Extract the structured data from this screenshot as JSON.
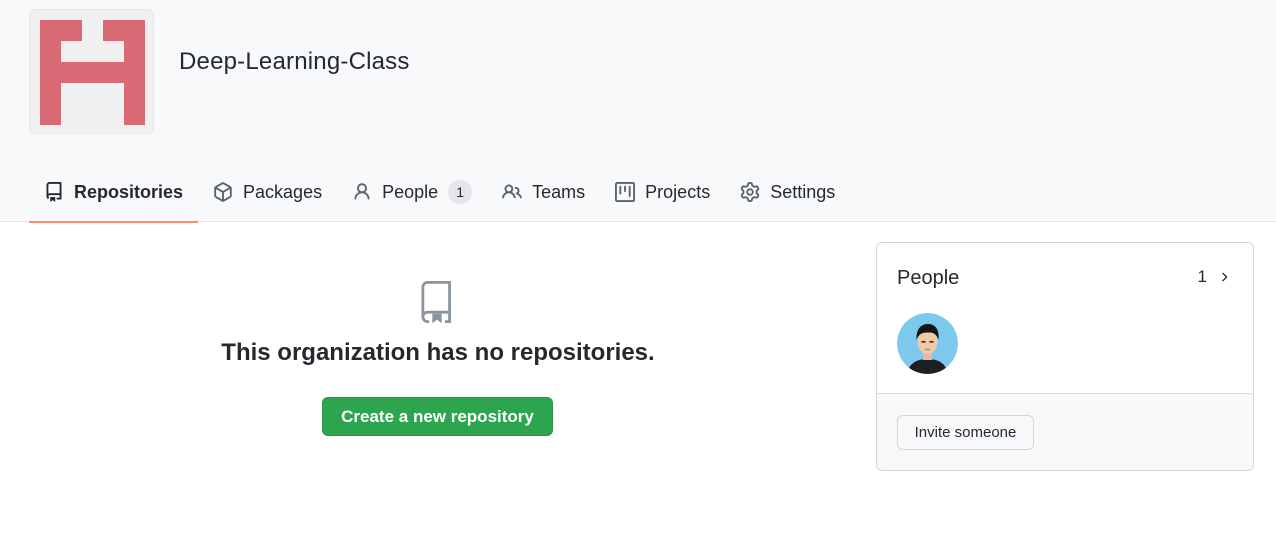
{
  "org": {
    "name": "Deep-Learning-Class",
    "avatar_color": "#d86b75"
  },
  "tabs": [
    {
      "label": "Repositories",
      "icon": "repo-icon",
      "active": true
    },
    {
      "label": "Packages",
      "icon": "package-icon",
      "active": false
    },
    {
      "label": "People",
      "icon": "person-icon",
      "active": false,
      "counter": "1"
    },
    {
      "label": "Teams",
      "icon": "people-icon",
      "active": false
    },
    {
      "label": "Projects",
      "icon": "project-icon",
      "active": false
    },
    {
      "label": "Settings",
      "icon": "gear-icon",
      "active": false
    }
  ],
  "blankslate": {
    "icon": "repo-icon",
    "title": "This organization has no repositories.",
    "button_label": "Create a new repository"
  },
  "people_sidebar": {
    "title": "People",
    "count": "1",
    "invite_label": "Invite someone"
  },
  "colors": {
    "accent_tab": "#fd8c73",
    "primary_button": "#2da44e",
    "avatar_bg": "#7cc8ef"
  }
}
